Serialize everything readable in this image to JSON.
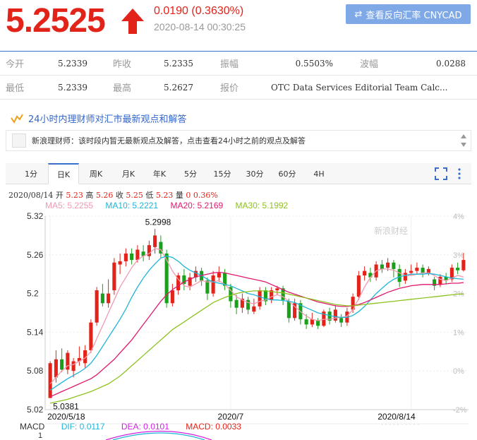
{
  "header": {
    "price": "5.2525",
    "change": "0.0190 (0.3630%)",
    "timestamp": "2020-08-14 00:30:25",
    "reverse_button_label": "查看反向汇率 CNYCAD",
    "price_color": "#e2231a"
  },
  "quote": {
    "rows": [
      [
        {
          "label": "今开",
          "value": "5.2339"
        },
        {
          "label": "昨收",
          "value": "5.2335"
        },
        {
          "label": "振幅",
          "value": "0.5503%"
        },
        {
          "label": "波幅",
          "value": "0.0288"
        }
      ],
      [
        {
          "label": "最低",
          "value": "5.2339"
        },
        {
          "label": "最高",
          "value": "5.2627"
        },
        {
          "label": "报价",
          "value": "OTC Data Services Editorial Team Calc..."
        },
        {
          "label": "",
          "value": ""
        }
      ]
    ]
  },
  "h24": {
    "title": "24小时内理财师对汇市最新观点和解答",
    "message": "新浪理财师：该时段内暂无最新观点及解答，点击查看24小时之前的观点及解答"
  },
  "tabs": [
    "1分",
    "日K",
    "周K",
    "月K",
    "年K",
    "5分",
    "15分",
    "30分",
    "60分",
    "4H"
  ],
  "active_tab": "日K",
  "info_line": {
    "date": "2020/08/14",
    "open_label": "开",
    "open": "5.23",
    "high_label": "高",
    "high": "5.26",
    "close_label": "收",
    "close": "5.25",
    "low_label": "低",
    "low": "5.23",
    "vol_label": "量",
    "vol": "0",
    "pct": "0.36%"
  },
  "ma_legend": [
    {
      "label": "MA5: 5.2255",
      "color": "#f29bb0"
    },
    {
      "label": "MA10: 5.2221",
      "color": "#1fb5d6"
    },
    {
      "label": "MA20: 5.2169",
      "color": "#e0196e"
    },
    {
      "label": "MA30: 5.1992",
      "color": "#8dc21f"
    }
  ],
  "macd": {
    "title": "MACD",
    "dif": "DIF: 0.0117",
    "dea": "DEA: 0.0101",
    "macd": "MACD: 0.0033",
    "axis_value": "1"
  },
  "watermark": "新浪财经",
  "chart_data": {
    "type": "candlestick",
    "title": "",
    "y_ticks": [
      "5.32",
      "5.26",
      "5.2",
      "5.14",
      "5.08",
      "5.02"
    ],
    "y_tick_values": [
      5.32,
      5.26,
      5.2,
      5.14,
      5.08,
      5.02
    ],
    "pct_ticks": [
      "4%",
      "3%",
      "2%",
      "1%",
      "0%",
      "-2%"
    ],
    "x_ticks": [
      "2020/5/18",
      "2020/7",
      "2020/8/14"
    ],
    "x_tick_index": [
      0,
      31,
      62
    ],
    "ylim": [
      5.02,
      5.32
    ],
    "annotations": [
      {
        "text": "5.2998",
        "index": 18,
        "value": 5.2998
      },
      {
        "text": "5.0381",
        "index": 0,
        "value": 5.0381
      }
    ],
    "up_color": "#e2231a",
    "down_color": "#1aa01a",
    "candles": [
      [
        5.038,
        5.092,
        5.095,
        5.038
      ],
      [
        5.07,
        5.098,
        5.112,
        5.062
      ],
      [
        5.098,
        5.082,
        5.115,
        5.078
      ],
      [
        5.082,
        5.108,
        5.112,
        5.075
      ],
      [
        5.08,
        5.095,
        5.1,
        5.07
      ],
      [
        5.095,
        5.1,
        5.118,
        5.088
      ],
      [
        5.092,
        5.112,
        5.12,
        5.085
      ],
      [
        5.112,
        5.155,
        5.16,
        5.108
      ],
      [
        5.155,
        5.205,
        5.21,
        5.15
      ],
      [
        5.2,
        5.185,
        5.215,
        5.18
      ],
      [
        5.185,
        5.2,
        5.222,
        5.178
      ],
      [
        5.205,
        5.248,
        5.255,
        5.198
      ],
      [
        5.245,
        5.25,
        5.262,
        5.23
      ],
      [
        5.25,
        5.262,
        5.27,
        5.242
      ],
      [
        5.262,
        5.252,
        5.27,
        5.245
      ],
      [
        5.252,
        5.268,
        5.275,
        5.248
      ],
      [
        5.265,
        5.258,
        5.275,
        5.25
      ],
      [
        5.258,
        5.275,
        5.282,
        5.252
      ],
      [
        5.272,
        5.29,
        5.3,
        5.262
      ],
      [
        5.28,
        5.262,
        5.29,
        5.255
      ],
      [
        5.262,
        5.185,
        5.268,
        5.178
      ],
      [
        5.185,
        5.205,
        5.215,
        5.18
      ],
      [
        5.205,
        5.228,
        5.232,
        5.198
      ],
      [
        5.228,
        5.215,
        5.238,
        5.205
      ],
      [
        5.212,
        5.225,
        5.232,
        5.205
      ],
      [
        5.225,
        5.235,
        5.242,
        5.218
      ],
      [
        5.235,
        5.22,
        5.24,
        5.212
      ],
      [
        5.22,
        5.2,
        5.225,
        5.19
      ],
      [
        5.2,
        5.228,
        5.235,
        5.195
      ],
      [
        5.225,
        5.232,
        5.242,
        5.218
      ],
      [
        5.232,
        5.212,
        5.238,
        5.205
      ],
      [
        5.21,
        5.188,
        5.215,
        5.178
      ],
      [
        5.19,
        5.178,
        5.198,
        5.168
      ],
      [
        5.178,
        5.192,
        5.2,
        5.17
      ],
      [
        5.19,
        5.175,
        5.195,
        5.168
      ],
      [
        5.172,
        5.18,
        5.192,
        5.168
      ],
      [
        5.18,
        5.205,
        5.21,
        5.175
      ],
      [
        5.205,
        5.188,
        5.21,
        5.182
      ],
      [
        5.19,
        5.205,
        5.21,
        5.185
      ],
      [
        5.205,
        5.208,
        5.212,
        5.198
      ],
      [
        5.208,
        5.19,
        5.212,
        5.182
      ],
      [
        5.188,
        5.162,
        5.192,
        5.155
      ],
      [
        5.162,
        5.185,
        5.192,
        5.158
      ],
      [
        5.185,
        5.16,
        5.19,
        5.152
      ],
      [
        5.16,
        5.152,
        5.168,
        5.145
      ],
      [
        5.152,
        5.16,
        5.17,
        5.148
      ],
      [
        5.158,
        5.15,
        5.162,
        5.145
      ],
      [
        5.15,
        5.172,
        5.175,
        5.148
      ],
      [
        5.172,
        5.158,
        5.178,
        5.152
      ],
      [
        5.158,
        5.175,
        5.182,
        5.155
      ],
      [
        5.162,
        5.155,
        5.168,
        5.148
      ],
      [
        5.155,
        5.172,
        5.178,
        5.15
      ],
      [
        5.175,
        5.195,
        5.2,
        5.17
      ],
      [
        5.195,
        5.228,
        5.235,
        5.19
      ],
      [
        5.228,
        5.235,
        5.242,
        5.22
      ],
      [
        5.232,
        5.225,
        5.24,
        5.218
      ],
      [
        5.225,
        5.245,
        5.25,
        5.22
      ],
      [
        5.245,
        5.238,
        5.252,
        5.232
      ],
      [
        5.24,
        5.248,
        5.255,
        5.235
      ],
      [
        5.248,
        5.238,
        5.252,
        5.225
      ],
      [
        5.238,
        5.218,
        5.245,
        5.21
      ],
      [
        5.22,
        5.232,
        5.238,
        5.215
      ],
      [
        5.232,
        5.235,
        5.245,
        5.228
      ],
      [
        5.235,
        5.24,
        5.248,
        5.23
      ],
      [
        5.24,
        5.232,
        5.245,
        5.225
      ],
      [
        5.232,
        5.238,
        5.242,
        5.228
      ],
      [
        5.222,
        5.212,
        5.226,
        5.205
      ],
      [
        5.214,
        5.226,
        5.23,
        5.21
      ],
      [
        5.226,
        5.22,
        5.232,
        5.214
      ],
      [
        5.222,
        5.24,
        5.245,
        5.218
      ],
      [
        5.24,
        5.236,
        5.248,
        5.23
      ],
      [
        5.236,
        5.252,
        5.263,
        5.234
      ]
    ],
    "ma_series": [
      {
        "name": "MA5",
        "color": "#f29bb0",
        "values": [
          5.06,
          5.07,
          5.08,
          5.088,
          5.09,
          5.095,
          5.1,
          5.11,
          5.13,
          5.15,
          5.17,
          5.19,
          5.21,
          5.225,
          5.24,
          5.252,
          5.258,
          5.262,
          5.27,
          5.268,
          5.252,
          5.235,
          5.222,
          5.212,
          5.21,
          5.215,
          5.22,
          5.218,
          5.218,
          5.22,
          5.214,
          5.205,
          5.195,
          5.19,
          5.186,
          5.184,
          5.188,
          5.19,
          5.195,
          5.198,
          5.195,
          5.188,
          5.18,
          5.172,
          5.165,
          5.16,
          5.158,
          5.16,
          5.16,
          5.162,
          5.163,
          5.165,
          5.175,
          5.192,
          5.21,
          5.225,
          5.235,
          5.238,
          5.238,
          5.236,
          5.232,
          5.228,
          5.228,
          5.23,
          5.232,
          5.232,
          5.228,
          5.222,
          5.22,
          5.224,
          5.228,
          5.2255
        ]
      },
      {
        "name": "MA10",
        "color": "#1fb5d6",
        "values": [
          5.05,
          5.056,
          5.062,
          5.068,
          5.073,
          5.078,
          5.084,
          5.092,
          5.104,
          5.118,
          5.132,
          5.146,
          5.16,
          5.176,
          5.194,
          5.21,
          5.224,
          5.236,
          5.246,
          5.255,
          5.258,
          5.256,
          5.25,
          5.242,
          5.236,
          5.232,
          5.228,
          5.222,
          5.218,
          5.216,
          5.214,
          5.212,
          5.208,
          5.204,
          5.2,
          5.198,
          5.195,
          5.192,
          5.19,
          5.19,
          5.189,
          5.188,
          5.186,
          5.182,
          5.178,
          5.174,
          5.17,
          5.168,
          5.166,
          5.164,
          5.163,
          5.163,
          5.166,
          5.172,
          5.18,
          5.19,
          5.2,
          5.208,
          5.216,
          5.222,
          5.226,
          5.228,
          5.23,
          5.23,
          5.23,
          5.231,
          5.23,
          5.228,
          5.226,
          5.224,
          5.223,
          5.2221
        ]
      },
      {
        "name": "MA20",
        "color": "#e0196e",
        "values": [
          5.04,
          5.044,
          5.048,
          5.052,
          5.056,
          5.06,
          5.064,
          5.068,
          5.074,
          5.082,
          5.09,
          5.098,
          5.108,
          5.118,
          5.128,
          5.14,
          5.152,
          5.164,
          5.176,
          5.188,
          5.198,
          5.206,
          5.212,
          5.218,
          5.222,
          5.226,
          5.228,
          5.23,
          5.232,
          5.233,
          5.232,
          5.23,
          5.228,
          5.226,
          5.224,
          5.222,
          5.22,
          5.218,
          5.214,
          5.21,
          5.206,
          5.202,
          5.199,
          5.196,
          5.193,
          5.19,
          5.187,
          5.185,
          5.183,
          5.181,
          5.18,
          5.18,
          5.181,
          5.183,
          5.186,
          5.19,
          5.194,
          5.198,
          5.202,
          5.205,
          5.208,
          5.21,
          5.212,
          5.213,
          5.214,
          5.214,
          5.214,
          5.214,
          5.215,
          5.216,
          5.216,
          5.2169
        ]
      },
      {
        "name": "MA30",
        "color": "#8dc21f",
        "values": [
          5.03,
          5.032,
          5.034,
          5.036,
          5.039,
          5.042,
          5.045,
          5.048,
          5.052,
          5.056,
          5.06,
          5.066,
          5.072,
          5.08,
          5.088,
          5.096,
          5.104,
          5.112,
          5.12,
          5.128,
          5.136,
          5.144,
          5.15,
          5.156,
          5.162,
          5.168,
          5.174,
          5.18,
          5.186,
          5.19,
          5.194,
          5.197,
          5.2,
          5.202,
          5.203,
          5.204,
          5.204,
          5.204,
          5.203,
          5.202,
          5.201,
          5.199,
          5.197,
          5.195,
          5.193,
          5.191,
          5.189,
          5.187,
          5.185,
          5.183,
          5.182,
          5.181,
          5.181,
          5.182,
          5.183,
          5.184,
          5.185,
          5.186,
          5.187,
          5.188,
          5.189,
          5.19,
          5.191,
          5.192,
          5.193,
          5.194,
          5.195,
          5.196,
          5.197,
          5.198,
          5.199,
          5.1992
        ]
      }
    ],
    "macd_series": [
      {
        "name": "DIF",
        "color": "#1fb5d6"
      },
      {
        "name": "DEA",
        "color": "#d020e0"
      },
      {
        "name": "MACD",
        "color": "#e2231a"
      }
    ],
    "grid": true
  }
}
